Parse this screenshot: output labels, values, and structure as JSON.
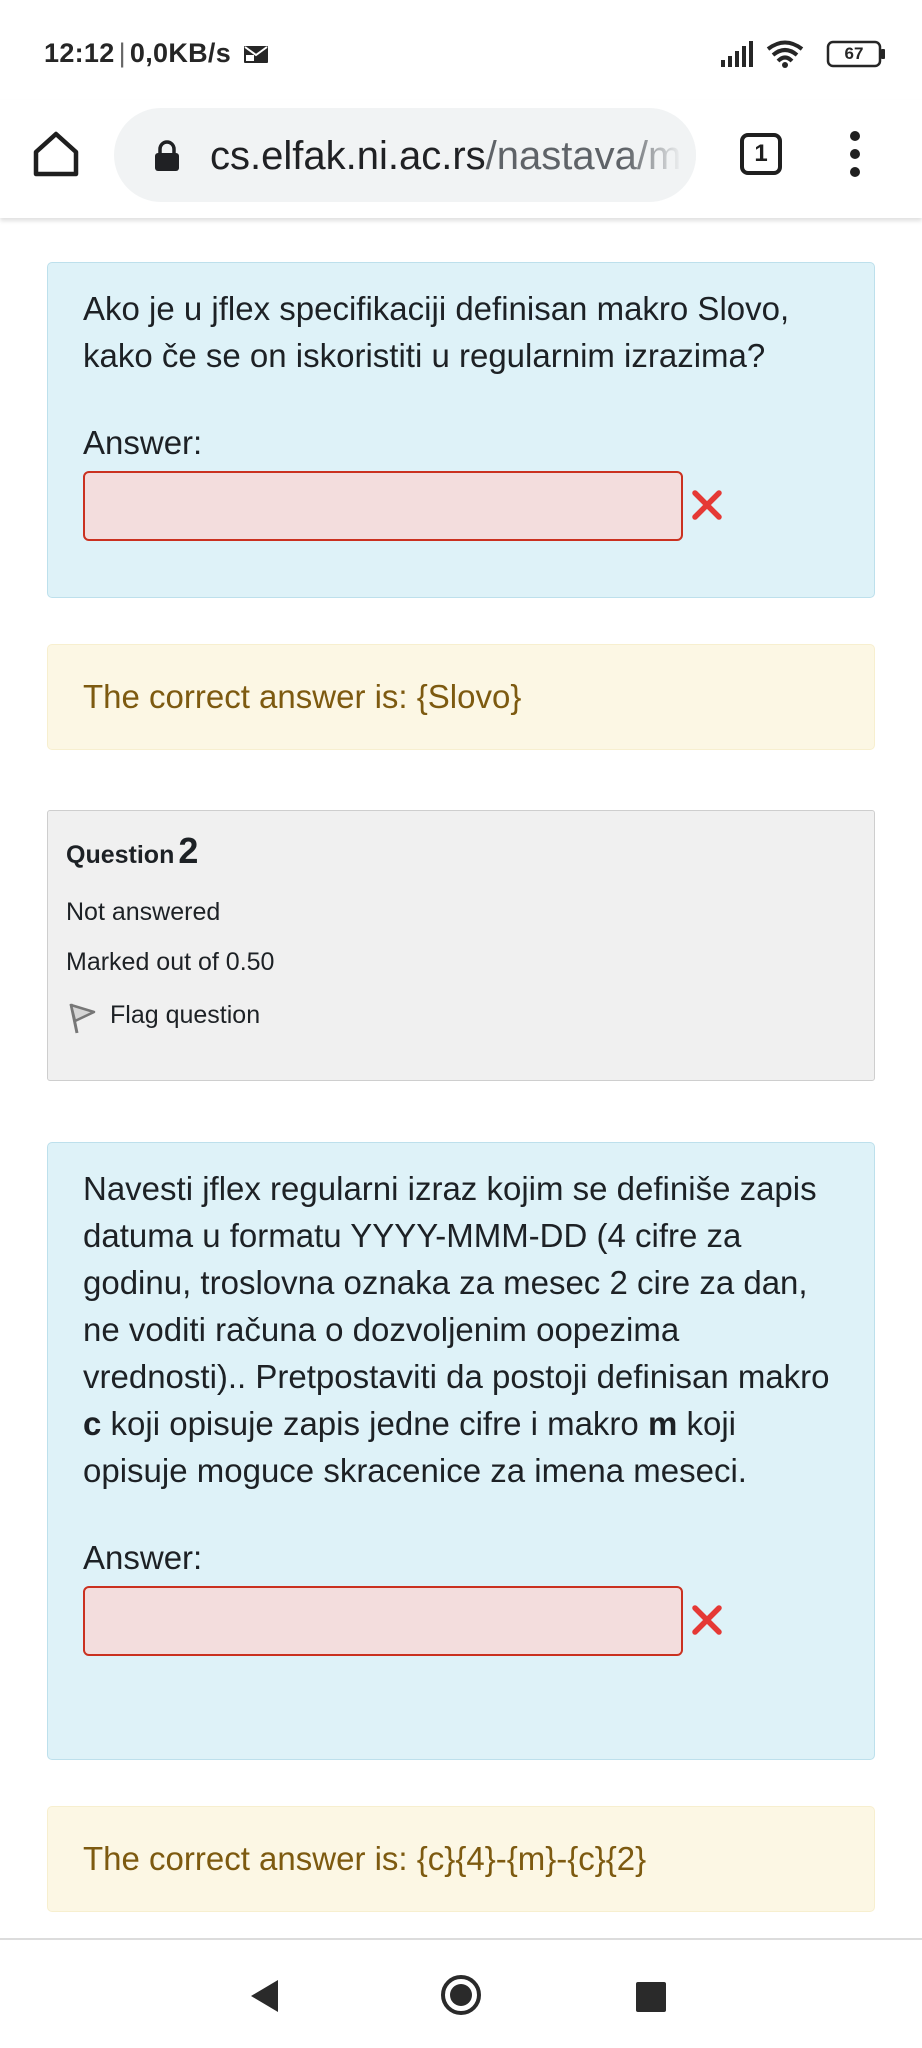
{
  "status_bar": {
    "time": "12:12",
    "network_speed": "0,0KB/s",
    "battery_level": "67",
    "icons": [
      "mail-icon",
      "signal-icon",
      "wifi-icon",
      "battery-icon"
    ]
  },
  "browser": {
    "url_host": "cs.elfak.ni.ac.rs",
    "url_path": "/nastava/m",
    "tab_count": "1",
    "icons": [
      "home-icon",
      "lock-icon",
      "tabs-icon",
      "more-vert-icon"
    ]
  },
  "question1": {
    "text": "Ako je u jflex specifikaciji definisan makro Slovo, kako če se on iskoristiti u regularnim izrazima?",
    "answer_label": "Answer:",
    "answer_value": "",
    "result_icon": "incorrect-cross-icon",
    "correct_answer": "The correct answer is: {Slovo}"
  },
  "question2_info": {
    "label": "Question",
    "number": "2",
    "status": "Not answered",
    "marks": "Marked out of 0.50",
    "flag_label": "Flag question"
  },
  "question2": {
    "text_part1": "Navesti jflex regularni izraz kojim se definiše zapis datuma u formatu YYYY-MMM-DD (4 cifre za godinu, troslovna oznaka za mesec 2 cire za dan, ne voditi računa o dozvoljenim oopezima vrednosti).. Pretpostaviti da postoji definisan makro ",
    "macro_c": "c",
    "text_part2": " koji opisuje zapis jedne cifre i makro ",
    "macro_m": "m",
    "text_part3": " koji opisuje moguce skracenice za imena meseci.",
    "answer_label": "Answer:",
    "answer_value": "",
    "result_icon": "incorrect-cross-icon",
    "correct_answer": "The correct answer is: {c}{4}-{m}-{c}{2}"
  },
  "nav_bar": {
    "icons": [
      "back-icon",
      "home-circle-icon",
      "recents-icon"
    ]
  },
  "colors": {
    "qtext_bg": "#def2f8",
    "feedback_bg": "#fcf7e4",
    "feedback_text": "#7d5a10",
    "incorrect_red": "#e53935",
    "info_bg": "#f0f0f0"
  }
}
